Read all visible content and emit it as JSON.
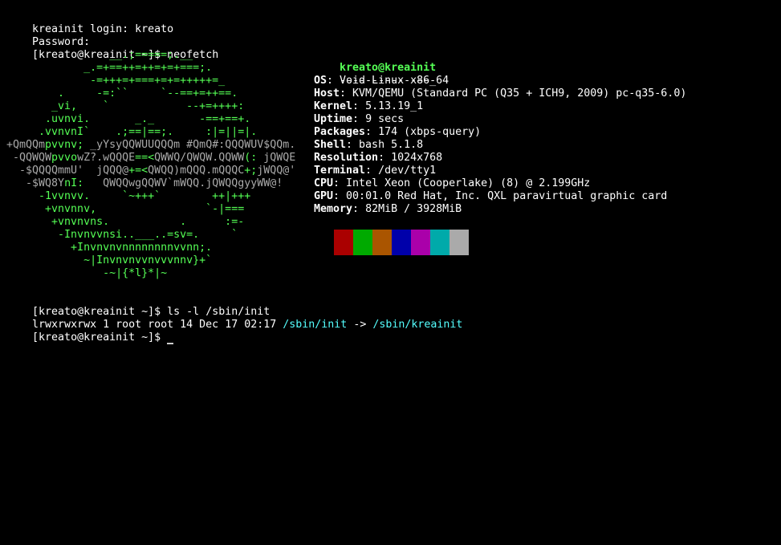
{
  "terminal": {
    "login_line": "kreainit login: kreato",
    "password_line": "Password:",
    "prompt": "[kreato@kreainit ~]$ ",
    "cmd_neofetch": "neofetch",
    "cmd_ls": "ls -l /sbin/init",
    "ls_output_prefix": "lrwxrwxrwx 1 root root 14 Dec 17 02:17 ",
    "ls_output_link": "/sbin/init",
    "ls_output_arrow": " -> ",
    "ls_output_target": "/sbin/kreainit",
    "final_prompt": "[kreato@kreainit ~]$ "
  },
  "logo": [
    [
      {
        "t": "                ",
        "c": "lg"
      },
      {
        "t": "__.;=====;.__",
        "c": "lg"
      }
    ],
    [
      {
        "t": "            _.=+==++=++=+=+===;.",
        "c": "lg"
      }
    ],
    [
      {
        "t": "             -=+++=+===+=+=+++++=_",
        "c": "lg"
      }
    ],
    [
      {
        "t": "        .     -=:``     `--==+=++==.",
        "c": "lg"
      }
    ],
    [
      {
        "t": "       _vi,    `            --+=++++:",
        "c": "lg"
      }
    ],
    [
      {
        "t": "      .uvnvi.       _._       -==+==+.",
        "c": "lg"
      }
    ],
    [
      {
        "t": "     .vvnvnI`    .;==|==;.     :|=||=|.",
        "c": "lg"
      }
    ],
    [
      {
        "t": "+QmQQm",
        "c": "gray"
      },
      {
        "t": "pvvnv; ",
        "c": "lg"
      },
      {
        "t": "_yYsyQQWUUQQQm #QmQ#:QQQWUV$QQm.",
        "c": "gray"
      }
    ],
    [
      {
        "t": " -QQWQW",
        "c": "gray"
      },
      {
        "t": "pvvo",
        "c": "lg"
      },
      {
        "t": "wZ?.wQQQE",
        "c": "gray"
      },
      {
        "t": "==<",
        "c": "lg"
      },
      {
        "t": "QWWQ/QWQW.QQWW",
        "c": "gray"
      },
      {
        "t": "(: ",
        "c": "lg"
      },
      {
        "t": "jQWQE",
        "c": "gray"
      }
    ],
    [
      {
        "t": "  -$QQQQmmU'  jQQQ@",
        "c": "gray"
      },
      {
        "t": "+=<",
        "c": "lg"
      },
      {
        "t": "QWQQ)mQQQ.mQQQC",
        "c": "gray"
      },
      {
        "t": "+;",
        "c": "lg"
      },
      {
        "t": "jWQQ@'",
        "c": "gray"
      }
    ],
    [
      {
        "t": "   -$WQ8Y",
        "c": "gray"
      },
      {
        "t": "nI:",
        "c": "lg"
      },
      {
        "t": "   QWQQwgQQWV`mWQQ.jQWQQgyyWW@!",
        "c": "gray"
      }
    ],
    [
      {
        "t": "     -1vvnvv.     `~+++`        ++|+++",
        "c": "lg"
      }
    ],
    [
      {
        "t": "      +vnvnnv,                 `-|===",
        "c": "lg"
      }
    ],
    [
      {
        "t": "       +vnvnvns.           .      :=-",
        "c": "lg"
      }
    ],
    [
      {
        "t": "        -Invnvvnsi..___..=sv=.     `",
        "c": "lg"
      }
    ],
    [
      {
        "t": "          +Invnvnvnnnnnnnnvvnn;.",
        "c": "lg"
      }
    ],
    [
      {
        "t": "            ~|Invnvnvvnvvvnnv}+`",
        "c": "lg"
      }
    ],
    [
      {
        "t": "               -~|{*l}*|~",
        "c": "lg"
      }
    ]
  ],
  "info": {
    "user_host": "kreato@kreainit",
    "separator": "---------------",
    "fields": [
      {
        "key": "OS",
        "value": "Void Linux x86_64"
      },
      {
        "key": "Host",
        "value": "KVM/QEMU (Standard PC (Q35 + ICH9, 2009) pc-q35-6.0)"
      },
      {
        "key": "Kernel",
        "value": "5.13.19_1"
      },
      {
        "key": "Uptime",
        "value": "9 secs"
      },
      {
        "key": "Packages",
        "value": "174 (xbps-query)"
      },
      {
        "key": "Shell",
        "value": "bash 5.1.8"
      },
      {
        "key": "Resolution",
        "value": "1024x768"
      },
      {
        "key": "Terminal",
        "value": "/dev/tty1"
      },
      {
        "key": "CPU",
        "value": "Intel Xeon (Cooperlake) (8) @ 2.199GHz"
      },
      {
        "key": "GPU",
        "value": "00:01.0 Red Hat, Inc. QXL paravirtual graphic card"
      },
      {
        "key": "Memory",
        "value": "82MiB / 3928MiB"
      }
    ]
  },
  "palette": [
    "#aa0000",
    "#00aa00",
    "#aa5500",
    "#0000aa",
    "#aa00aa",
    "#00aaaa",
    "#aaaaaa"
  ]
}
